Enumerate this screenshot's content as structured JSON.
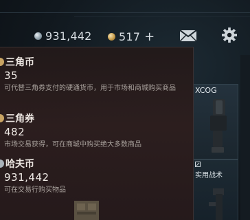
{
  "header": {
    "hafu_amount": "931,442",
    "coupon_amount": "517",
    "plus_label": "+"
  },
  "tooltip": {
    "entries": [
      {
        "name": "三角币",
        "value": "35",
        "description": "可代替三角券支付的硬通货币，用于市场和商城购买商品",
        "coin_color": "#c9a463"
      },
      {
        "name": "三角券",
        "value": "482",
        "description": "市场交易获得，可在商城中购买绝大多数商品",
        "coin_color": "#c9a463"
      },
      {
        "name": "哈夫币",
        "value": "931,442",
        "description": "可在交易行购买物品",
        "coin_color": "#aab3ba"
      }
    ]
  },
  "items": {
    "card1_label": "XCOG",
    "card2_label": "实用战术"
  },
  "icons": {
    "mail": "mail-icon",
    "settings": "gear-icon"
  }
}
